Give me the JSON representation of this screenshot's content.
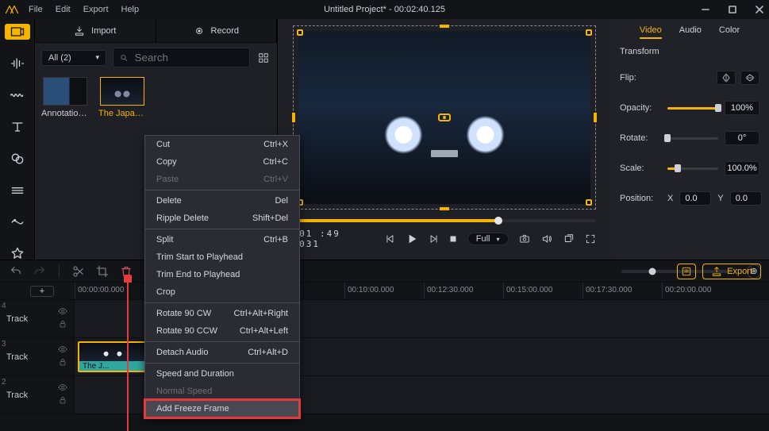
{
  "menubar": {
    "file": "File",
    "edit": "Edit",
    "export": "Export",
    "help": "Help"
  },
  "title": "Untitled Project* - 00:02:40.125",
  "library": {
    "import_tab": "Import",
    "record_tab": "Record",
    "filter_label": "All (2)",
    "search_placeholder": "Search",
    "items": [
      {
        "label": "Annotation ...",
        "selected": false
      },
      {
        "label": "The Japane...",
        "selected": true
      }
    ]
  },
  "preview": {
    "time_display": ":01 :49 .031",
    "fit_label": "Full",
    "scrub_progress_pct": 68
  },
  "inspector": {
    "tabs": {
      "video": "Video",
      "audio": "Audio",
      "color": "Color"
    },
    "section": "Transform",
    "flip_label": "Flip:",
    "opacity_label": "Opacity:",
    "opacity_value": "100%",
    "rotate_label": "Rotate:",
    "rotate_value": "0°",
    "scale_label": "Scale:",
    "scale_value": "100.0%",
    "position_label": "Position:",
    "pos_x_prefix": "X",
    "pos_x_value": "0.0",
    "pos_y_prefix": "Y",
    "pos_y_value": "0.0"
  },
  "timeline": {
    "export_label": "Export",
    "ruler_start": "00:00:00.000",
    "ruler": [
      "00:10:00.000",
      "00:12:30.000",
      "00:15:00.000",
      "00:17:30.000",
      "00:20:00.000"
    ],
    "tracks": [
      {
        "no": "4",
        "label": "Track"
      },
      {
        "no": "3",
        "label": "Track",
        "clip_label": "The J..."
      },
      {
        "no": "2",
        "label": "Track"
      }
    ]
  },
  "context_menu": {
    "items": [
      {
        "label": "Cut",
        "shortcut": "Ctrl+X"
      },
      {
        "label": "Copy",
        "shortcut": "Ctrl+C"
      },
      {
        "label": "Paste",
        "shortcut": "Ctrl+V",
        "dim": true
      },
      {
        "sep": true
      },
      {
        "label": "Delete",
        "shortcut": "Del"
      },
      {
        "label": "Ripple Delete",
        "shortcut": "Shift+Del"
      },
      {
        "sep": true
      },
      {
        "label": "Split",
        "shortcut": "Ctrl+B"
      },
      {
        "label": "Trim Start to Playhead"
      },
      {
        "label": "Trim End to Playhead"
      },
      {
        "label": "Crop"
      },
      {
        "sep": true
      },
      {
        "label": "Rotate 90 CW",
        "shortcut": "Ctrl+Alt+Right"
      },
      {
        "label": "Rotate 90 CCW",
        "shortcut": "Ctrl+Alt+Left"
      },
      {
        "sep": true
      },
      {
        "label": "Detach Audio",
        "shortcut": "Ctrl+Alt+D"
      },
      {
        "sep": true
      },
      {
        "label": "Speed and Duration"
      },
      {
        "label": "Normal Speed",
        "dim": true
      },
      {
        "label": "Add Freeze Frame",
        "highlight": true
      }
    ]
  }
}
